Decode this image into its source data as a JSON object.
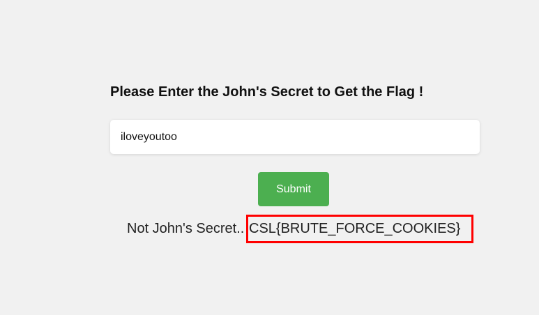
{
  "form": {
    "heading": "Please Enter the John's Secret to Get the Flag !",
    "secret_value": "iloveyoutoo",
    "submit_label": "Submit"
  },
  "result": {
    "message": "Not John's Secret..",
    "flag": "CSL{BRUTE_FORCE_COOKIES}"
  },
  "colors": {
    "background": "#f1f1f1",
    "button": "#4caf50",
    "highlight": "#ff0000"
  }
}
